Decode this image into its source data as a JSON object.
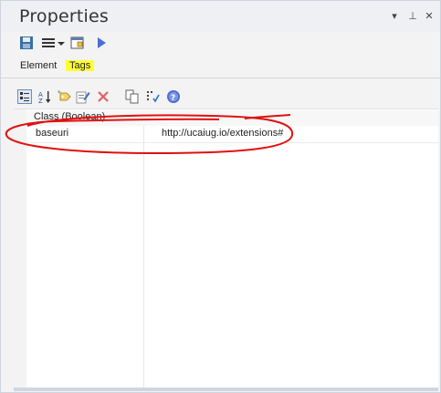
{
  "window": {
    "title": "Properties"
  },
  "tabs": [
    {
      "label": "Element",
      "selected": false
    },
    {
      "label": "Tags",
      "selected": true,
      "highlight": "#ffff33"
    }
  ],
  "grid": {
    "group_label": "Class (Boolean)",
    "rows": [
      {
        "name": "baseuri",
        "value": "http://ucaiug.io/extensions#"
      }
    ]
  },
  "icons": {
    "title_controls": [
      "dropdown-arrow-icon",
      "pin-icon",
      "close-icon"
    ],
    "toolbar1": [
      "save-icon",
      "menu-icon",
      "dropdown-caret-icon",
      "window-icon",
      "play-icon"
    ],
    "toolbar2": [
      "categorized-icon",
      "sort-az-icon",
      "new-tag-icon",
      "edit-icon",
      "delete-icon",
      "copy-icon",
      "settings-icon",
      "help-icon"
    ]
  },
  "colors": {
    "annotation": "#e01010",
    "tag_highlight": "#ffff33"
  }
}
